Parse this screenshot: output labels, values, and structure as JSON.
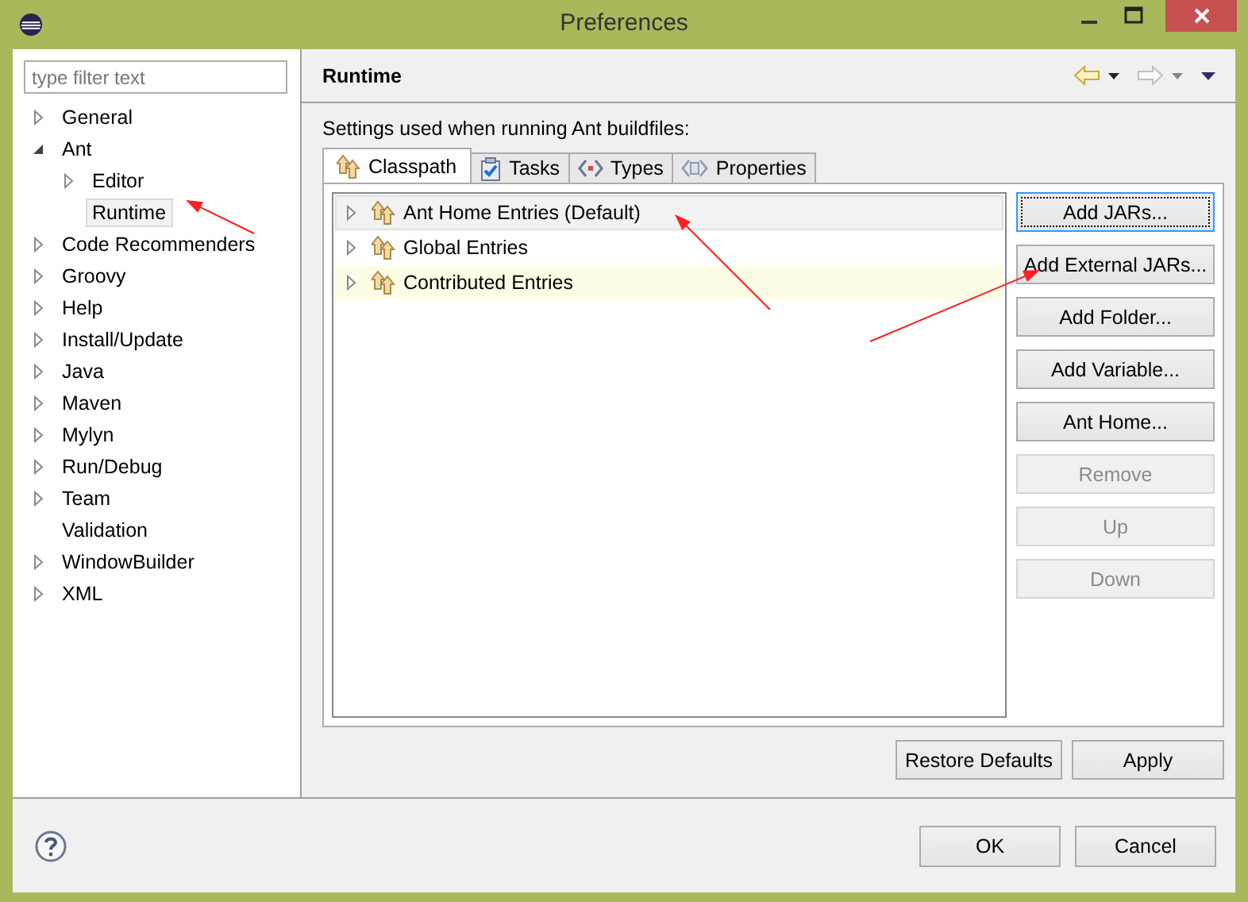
{
  "window": {
    "title": "Preferences"
  },
  "filter": {
    "placeholder": "type filter text"
  },
  "tree": [
    {
      "label": "General",
      "kind": "branch",
      "expanded": false,
      "selected": false
    },
    {
      "label": "Ant",
      "kind": "branch",
      "expanded": true,
      "selected": false,
      "children": [
        {
          "label": "Editor",
          "kind": "branch",
          "expanded": false,
          "selected": false
        },
        {
          "label": "Runtime",
          "kind": "leaf",
          "selected": true
        }
      ]
    },
    {
      "label": "Code Recommenders",
      "kind": "branch",
      "expanded": false,
      "selected": false
    },
    {
      "label": "Groovy",
      "kind": "branch",
      "expanded": false,
      "selected": false
    },
    {
      "label": "Help",
      "kind": "branch",
      "expanded": false,
      "selected": false
    },
    {
      "label": "Install/Update",
      "kind": "branch",
      "expanded": false,
      "selected": false
    },
    {
      "label": "Java",
      "kind": "branch",
      "expanded": false,
      "selected": false
    },
    {
      "label": "Maven",
      "kind": "branch",
      "expanded": false,
      "selected": false
    },
    {
      "label": "Mylyn",
      "kind": "branch",
      "expanded": false,
      "selected": false
    },
    {
      "label": "Run/Debug",
      "kind": "branch",
      "expanded": false,
      "selected": false
    },
    {
      "label": "Team",
      "kind": "branch",
      "expanded": false,
      "selected": false
    },
    {
      "label": "Validation",
      "kind": "leaf",
      "selected": false
    },
    {
      "label": "WindowBuilder",
      "kind": "branch",
      "expanded": false,
      "selected": false
    },
    {
      "label": "XML",
      "kind": "branch",
      "expanded": false,
      "selected": false
    }
  ],
  "page": {
    "title": "Runtime",
    "description": "Settings used when running Ant buildfiles:"
  },
  "tabs": [
    {
      "label": "Classpath",
      "kind": "classpath",
      "selected": true
    },
    {
      "label": "Tasks",
      "kind": "tasks",
      "selected": false
    },
    {
      "label": "Types",
      "kind": "types",
      "selected": false
    },
    {
      "label": "Properties",
      "kind": "properties",
      "selected": false
    }
  ],
  "entries": [
    {
      "label": "Ant Home Entries (Default)",
      "selected": true,
      "hovered": false
    },
    {
      "label": "Global Entries",
      "selected": false,
      "hovered": false
    },
    {
      "label": "Contributed Entries",
      "selected": false,
      "hovered": true
    }
  ],
  "side_buttons": [
    {
      "label": "Add JARs...",
      "disabled": false,
      "focused": true
    },
    {
      "label": "Add External JARs...",
      "disabled": false,
      "focused": false
    },
    {
      "label": "Add Folder...",
      "disabled": false,
      "focused": false
    },
    {
      "label": "Add Variable...",
      "disabled": false,
      "focused": false
    },
    {
      "label": "Ant Home...",
      "disabled": false,
      "focused": false
    },
    {
      "label": "Remove",
      "disabled": true,
      "focused": false
    },
    {
      "label": "Up",
      "disabled": true,
      "focused": false
    },
    {
      "label": "Down",
      "disabled": true,
      "focused": false
    }
  ],
  "page_buttons": [
    "Restore Defaults",
    "Apply"
  ],
  "dialog_buttons": [
    "OK",
    "Cancel"
  ]
}
